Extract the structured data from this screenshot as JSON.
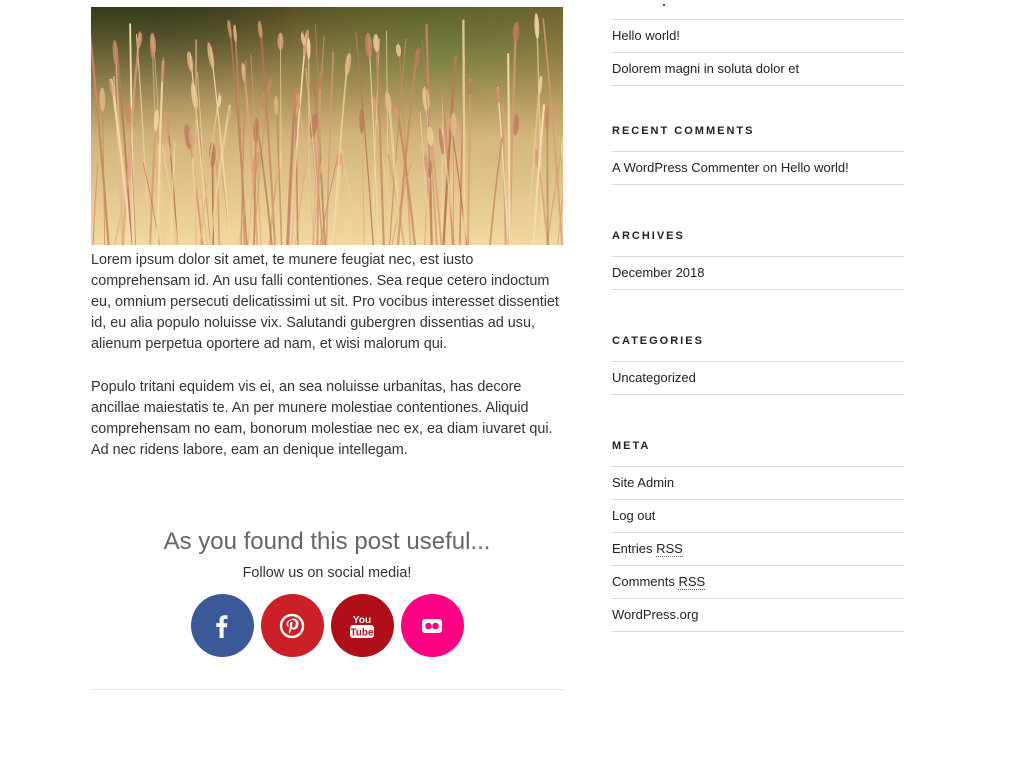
{
  "post": {
    "paragraphs": [
      "Lorem ipsum dolor sit amet, te munere feugiat nec, est iusto comprehensam id. An usu falli contentiones. Sea reque cetero indoctum eu, omnium persecuti delicatissimi ut sit. Pro vocibus interesset dissentiet id, eu alia populo noluisse vix. Salutandi gubergren dissentias ad usu, alienum perpetua oportere ad nam, et wisi malorum qui.",
      "Populo tritani equidem vis ei, an sea noluisse urbanitas, has decore ancillae maiestatis te. An per munere molestiae contentiones. Aliquid comprehensam no eam, bonorum molestiae nec ex, ea diam iuvaret qui. Ad nec ridens labore, eam an denique intellegam."
    ]
  },
  "share": {
    "heading": "As you found this post useful...",
    "subheading": "Follow us on social media!",
    "buttons": [
      {
        "icon": "facebook-icon",
        "color": "#3b5998"
      },
      {
        "icon": "pinterest-icon",
        "color": "#cb2027"
      },
      {
        "icon": "youtube-icon",
        "color": "#b00f19"
      },
      {
        "icon": "flickr-icon",
        "color": "#ff0084"
      }
    ],
    "youtube_text_top": "You",
    "youtube_text_bottom": "Tube"
  },
  "sidebar": {
    "recent_posts": {
      "items": [
        "Hello world!",
        "Dolorem magni in soluta dolor et"
      ]
    },
    "recent_comments": {
      "title": "RECENT COMMENTS",
      "author": "A WordPress Commenter",
      "connector": "on",
      "post": "Hello world!"
    },
    "archives": {
      "title": "ARCHIVES",
      "items": [
        "December 2018"
      ]
    },
    "categories": {
      "title": "CATEGORIES",
      "items": [
        "Uncategorized"
      ]
    },
    "meta": {
      "title": "META",
      "site_admin": "Site Admin",
      "log_out": "Log out",
      "entries_prefix": "Entries",
      "comments_prefix": "Comments",
      "rss": "RSS",
      "wordpress_org": "WordPress.org"
    }
  },
  "colors": {
    "facebook": "#3b5998",
    "pinterest": "#cb2027",
    "youtube": "#b00f19",
    "flickr": "#ff0084"
  }
}
